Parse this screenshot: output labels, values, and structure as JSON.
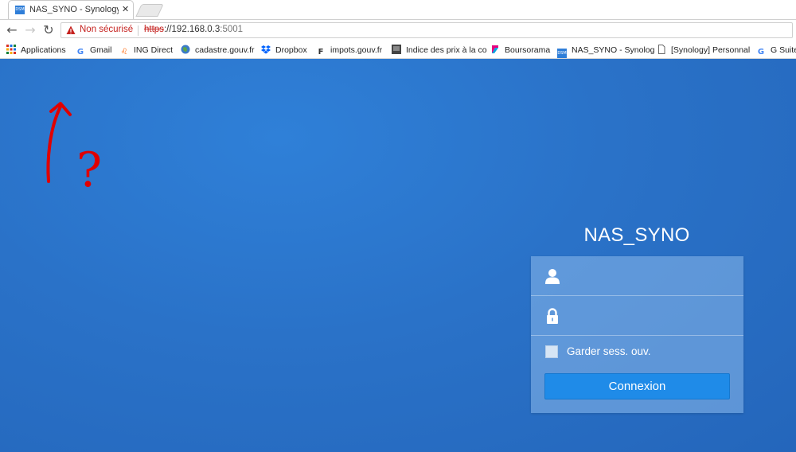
{
  "tab": {
    "title": "NAS_SYNO - Synology D",
    "favicon_label": "DSM",
    "close": "✕"
  },
  "toolbar": {
    "back": "←",
    "forward": "→",
    "reload": "↻",
    "security_text": "Non sécurisé",
    "url_protocol": "https",
    "url_rest": "://192.168.0.3",
    "url_port": ":5001"
  },
  "bookmarks": [
    {
      "label": "Applications",
      "icon": "apps-grid-icon"
    },
    {
      "label": "Gmail",
      "icon": "google-icon"
    },
    {
      "label": "ING Direct",
      "icon": "ing-lion-icon"
    },
    {
      "label": "cadastre.gouv.fr",
      "icon": "globe-icon"
    },
    {
      "label": "Dropbox",
      "icon": "dropbox-icon"
    },
    {
      "label": "impots.gouv.fr",
      "icon": "impots-icon"
    },
    {
      "label": "Indice des prix à la co",
      "icon": "insee-icon"
    },
    {
      "label": "Boursorama",
      "icon": "boursorama-icon"
    },
    {
      "label": "NAS_SYNO - Synolog",
      "icon": "dsm-icon"
    },
    {
      "label": "[Synology] Personnal",
      "icon": "page-icon"
    },
    {
      "label": "G Suite",
      "icon": "google-icon"
    }
  ],
  "login": {
    "server_name": "NAS_SYNO",
    "username_value": "",
    "password_value": "",
    "remember_label": "Garder sess. ouv.",
    "remember_checked": false,
    "submit_label": "Connexion"
  },
  "annotation": {
    "mark": "?",
    "color": "#e00000"
  },
  "colors": {
    "background": "#2a74c8",
    "button": "#1f8be8",
    "warning": "#c5221f"
  }
}
